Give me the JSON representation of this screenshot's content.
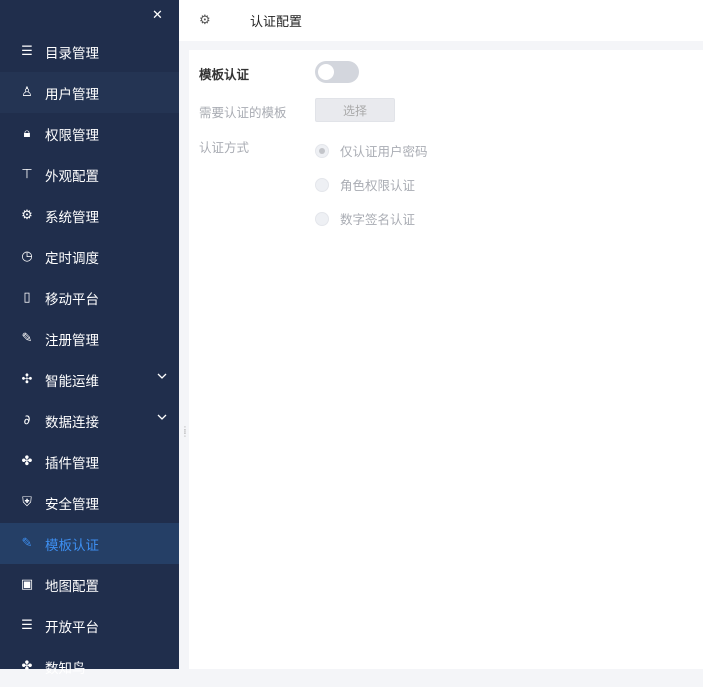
{
  "sidebar": {
    "items": [
      {
        "label": "目录管理",
        "icon": "list-icon"
      },
      {
        "label": "用户管理",
        "icon": "user-icon"
      },
      {
        "label": "权限管理",
        "icon": "lock-icon"
      },
      {
        "label": "外观配置",
        "icon": "paint-roller-icon"
      },
      {
        "label": "系统管理",
        "icon": "gear-icon"
      },
      {
        "label": "定时调度",
        "icon": "timer-icon"
      },
      {
        "label": "移动平台",
        "icon": "mobile-icon"
      },
      {
        "label": "注册管理",
        "icon": "register-icon"
      },
      {
        "label": "智能运维",
        "icon": "network-icon"
      },
      {
        "label": "数据连接",
        "icon": "paperclip-icon"
      },
      {
        "label": "插件管理",
        "icon": "puzzle-icon"
      },
      {
        "label": "安全管理",
        "icon": "shield-icon"
      },
      {
        "label": "模板认证",
        "icon": "template-auth-icon"
      },
      {
        "label": "地图配置",
        "icon": "map-icon"
      },
      {
        "label": "开放平台",
        "icon": "list-icon"
      },
      {
        "label": "数知鸟",
        "icon": "puzzle-icon"
      }
    ],
    "active": "模板认证",
    "accent": "#3d8ef0"
  },
  "header": {
    "title": "认证配置"
  },
  "form": {
    "template_auth_label": "模板认证",
    "template_auth_on": false,
    "templates_label": "需要认证的模板",
    "select_button": "选择",
    "method_label": "认证方式",
    "methods": [
      "仅认证用户密码",
      "角色权限认证",
      "数字签名认证"
    ],
    "selected_method": "仅认证用户密码"
  }
}
